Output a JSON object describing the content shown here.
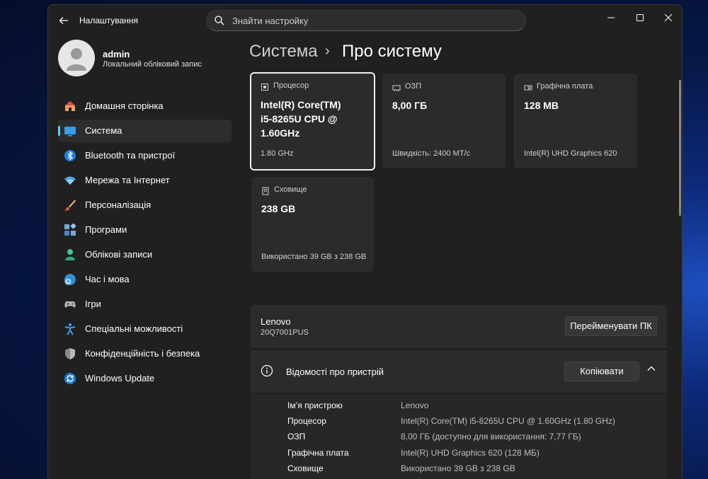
{
  "app": {
    "title": "Налаштування"
  },
  "search": {
    "placeholder": "Знайти настройку"
  },
  "user": {
    "name": "admin",
    "account_type": "Локальний обліковий запис"
  },
  "sidebar": {
    "items": [
      {
        "label": "Домашня сторінка",
        "icon": "home-icon"
      },
      {
        "label": "Система",
        "icon": "system-icon",
        "active": true
      },
      {
        "label": "Bluetooth та пристрої",
        "icon": "bluetooth-icon"
      },
      {
        "label": "Мережа та Інтернет",
        "icon": "wifi-icon"
      },
      {
        "label": "Персоналізація",
        "icon": "brush-icon"
      },
      {
        "label": "Програми",
        "icon": "apps-icon"
      },
      {
        "label": "Облікові записи",
        "icon": "accounts-icon"
      },
      {
        "label": "Час і мова",
        "icon": "time-language-icon"
      },
      {
        "label": "Ігри",
        "icon": "gamepad-icon"
      },
      {
        "label": "Спеціальні можливості",
        "icon": "accessibility-icon"
      },
      {
        "label": "Конфіденційність і безпека",
        "icon": "shield-icon"
      },
      {
        "label": "Windows Update",
        "icon": "update-icon"
      }
    ]
  },
  "breadcrumb": {
    "parent": "Система",
    "separator": "›",
    "current": "Про систему"
  },
  "cards": {
    "cpu": {
      "label": "Процесор",
      "value": "Intel(R) Core(TM)\ni5-8265U CPU @\n1.60GHz",
      "footer": "1.80 GHz"
    },
    "ram": {
      "label": "ОЗП",
      "value": "8,00 ГБ",
      "footer": "Швидкість: 2400 МТ/с"
    },
    "gpu": {
      "label": "Графічна плата",
      "value": "128 MB",
      "footer": "Intel(R) UHD Graphics 620"
    },
    "storage": {
      "label": "Сховище",
      "value": "238 GB",
      "footer": "Використано 39 GB з 238 GB"
    }
  },
  "device": {
    "name": "Lenovo",
    "model": "20Q7001PUS",
    "rename_label": "Перейменувати ПК"
  },
  "specs": {
    "title": "Відомості про пристрій",
    "copy_label": "Копіювати",
    "rows": [
      {
        "label": "Ім’я пристрою",
        "value": "Lenovo"
      },
      {
        "label": "Процесор",
        "value": "Intel(R) Core(TM) i5-8265U CPU @ 1.60GHz (1.80 GHz)"
      },
      {
        "label": "ОЗП",
        "value": "8,00 ГБ (доступно для використання: 7,77 ГБ)"
      },
      {
        "label": "Графічна плата",
        "value": "Intel(R) UHD Graphics 620 (128 МБ)"
      },
      {
        "label": "Сховище",
        "value": "Використано 39 GB з 238 GB"
      }
    ]
  },
  "colors": {
    "accent": "#60cdff",
    "window_bg": "#202020",
    "card_bg": "#2b2b2b"
  }
}
